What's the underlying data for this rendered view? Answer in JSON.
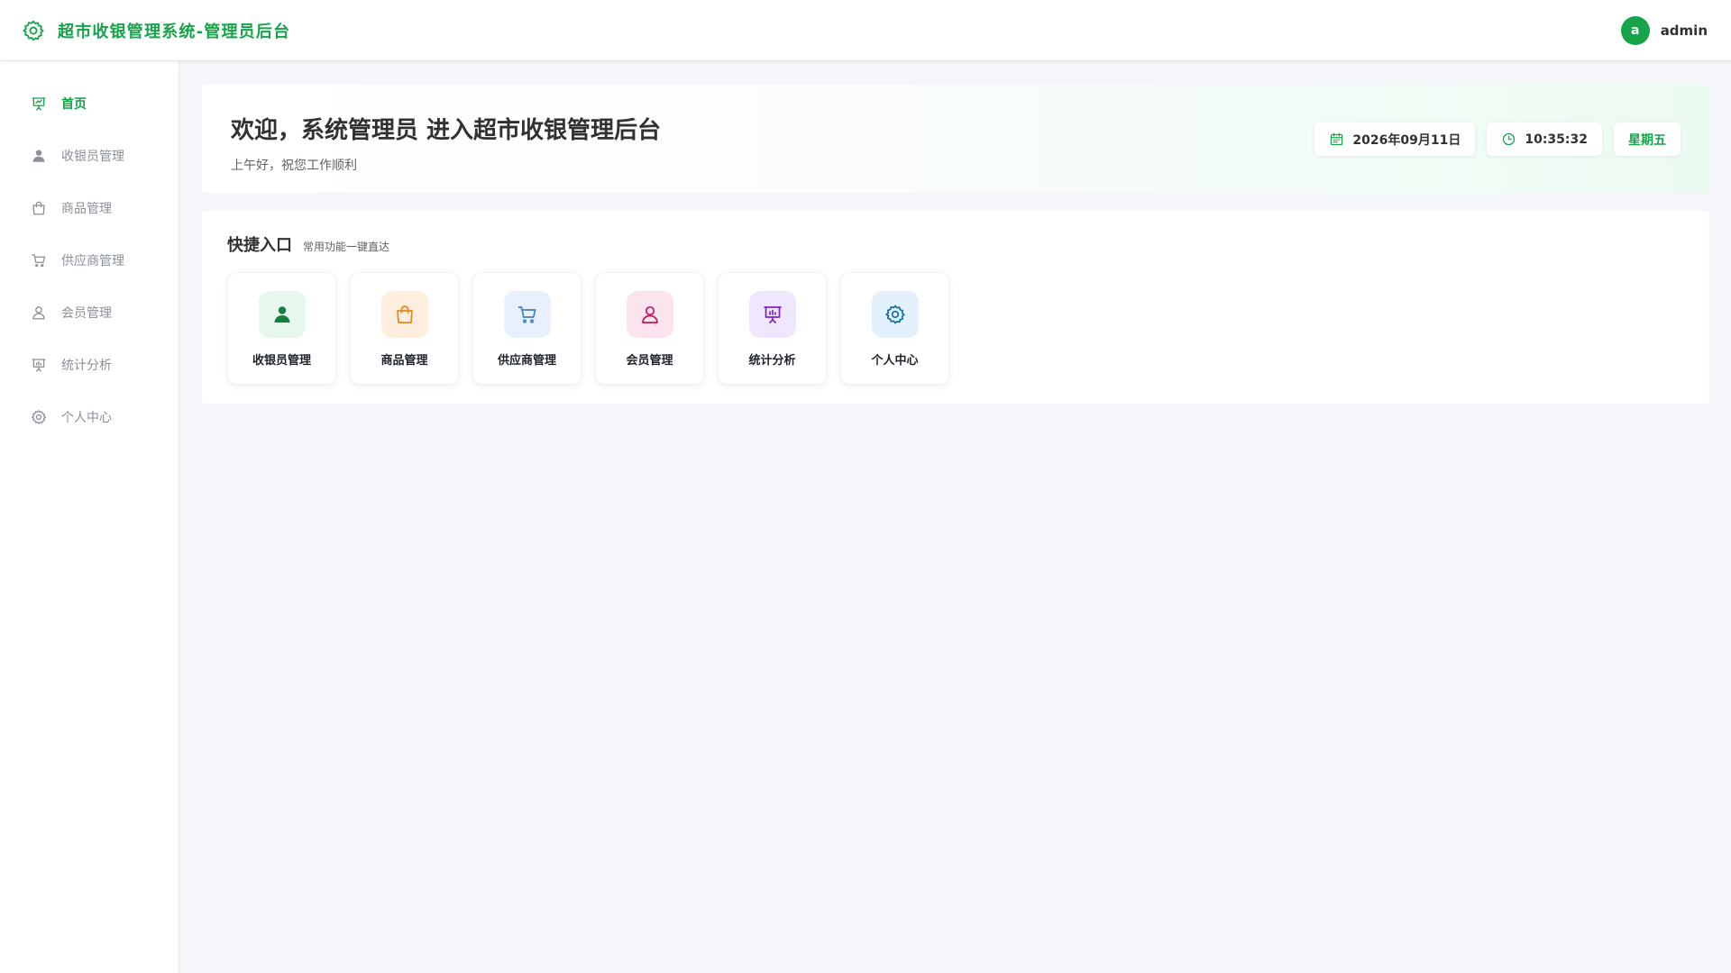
{
  "header": {
    "title": "超市收银管理系统-管理员后台",
    "brand_icon": "gear-icon",
    "avatar_letter": "a",
    "username": "admin"
  },
  "sidebar": {
    "items": [
      {
        "label": "首页",
        "icon": "presentation-chart-icon",
        "active": true
      },
      {
        "label": "收银员管理",
        "icon": "user-filled-icon"
      },
      {
        "label": "商品管理",
        "icon": "shopping-bag-icon"
      },
      {
        "label": "供应商管理",
        "icon": "cart-icon"
      },
      {
        "label": "会员管理",
        "icon": "user-outline-icon"
      },
      {
        "label": "统计分析",
        "icon": "presentation-chart-icon"
      },
      {
        "label": "个人中心",
        "icon": "gear-icon"
      }
    ]
  },
  "welcome": {
    "title": "欢迎，系统管理员 进入超市收银管理后台",
    "subtitle": "上午好，祝您工作顺利",
    "date": "2026年09月11日",
    "time": "10:35:32",
    "weekday": "星期五"
  },
  "quick": {
    "title": "快捷入口",
    "subtitle": "常用功能一键直达",
    "items": [
      {
        "label": "收银员管理",
        "icon": "user-filled-icon",
        "bg": "#e8f7ee",
        "color": "#15803d"
      },
      {
        "label": "商品管理",
        "icon": "shopping-bag-icon",
        "bg": "#fdeedd",
        "color": "#e8871e"
      },
      {
        "label": "供应商管理",
        "icon": "cart-icon",
        "bg": "#e8f1fb",
        "color": "#3b82c4"
      },
      {
        "label": "会员管理",
        "icon": "user-outline-icon",
        "bg": "#fce4ef",
        "color": "#be185d"
      },
      {
        "label": "统计分析",
        "icon": "presentation-chart-icon",
        "bg": "#efe7fb",
        "color": "#7e22ce"
      },
      {
        "label": "个人中心",
        "icon": "gear-icon",
        "bg": "#e2f1fb",
        "color": "#0e6ba8"
      }
    ]
  },
  "colors": {
    "brand": "#16a34a",
    "sidebar_text": "#8a8f98",
    "page_bg": "#f5f6fa"
  }
}
